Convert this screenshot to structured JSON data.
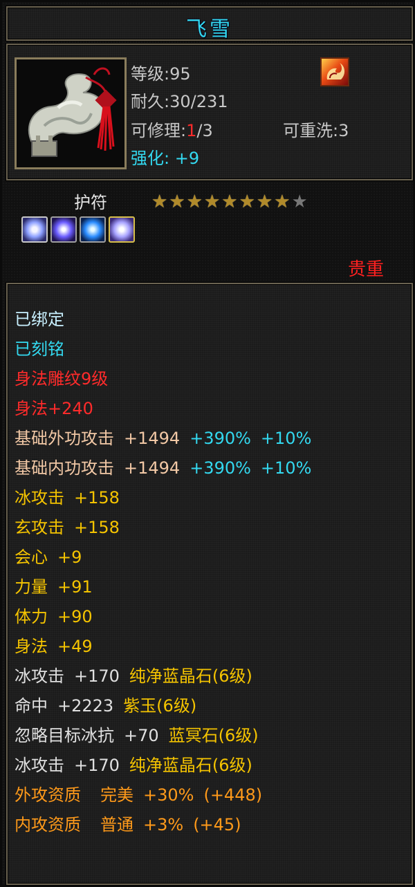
{
  "title": "飞雪",
  "info": {
    "level_label": "等级:",
    "level_value": "95",
    "durability_label": "耐久:",
    "durability_value": "30/231",
    "repair_label": "可修理:",
    "repair_current": "1",
    "repair_total": "/3",
    "rewash_label": "可重洗:",
    "rewash_value": "3",
    "enhance_label": "强化:",
    "enhance_value": "+9"
  },
  "amulet": {
    "label": "护符",
    "stars_filled": 8,
    "stars_total": 9,
    "precious_label": "贵重"
  },
  "colors": {
    "title": "#33d9f0",
    "cyan": "#33d9f0",
    "red": "#ff2b2b",
    "peach": "#f3c9a6",
    "yellow": "#f5c400",
    "orange": "#ff9a1a"
  },
  "stats": {
    "bound": "已绑定",
    "engraved": "已刻铭",
    "carve": "身法雕纹9级",
    "agility_bonus": "身法+240",
    "ext_atk": {
      "label": "基础外功攻击",
      "value": "+1494",
      "pct1": "+390%",
      "pct2": "+10%"
    },
    "int_atk": {
      "label": "基础内功攻击",
      "value": "+1494",
      "pct1": "+390%",
      "pct2": "+10%"
    },
    "ice_atk": {
      "label": "冰攻击",
      "value": "+158"
    },
    "dark_atk": {
      "label": "玄攻击",
      "value": "+158"
    },
    "crit": {
      "label": "会心",
      "value": "+9"
    },
    "strength": {
      "label": "力量",
      "value": "+91"
    },
    "stamina": {
      "label": "体力",
      "value": "+90"
    },
    "agility": {
      "label": "身法",
      "value": "+49"
    },
    "gem1": {
      "label": "冰攻击",
      "value": "+170",
      "gem": "纯净蓝晶石(6级)"
    },
    "gem2": {
      "label": "命中",
      "value": "+2223",
      "gem": "紫玉(6级)"
    },
    "gem3": {
      "label": "忽略目标冰抗",
      "value": "+70",
      "gem": "蓝冥石(6级)"
    },
    "gem4": {
      "label": "冰攻击",
      "value": "+170",
      "gem": "纯净蓝晶石(6级)"
    },
    "ext_quality": {
      "label": "外攻资质",
      "grade": "完美",
      "pct": "+30%",
      "bonus": "(+448)"
    },
    "int_quality": {
      "label": "内攻资质",
      "grade": "普通",
      "pct": "+3%",
      "bonus": "(+45)"
    }
  }
}
